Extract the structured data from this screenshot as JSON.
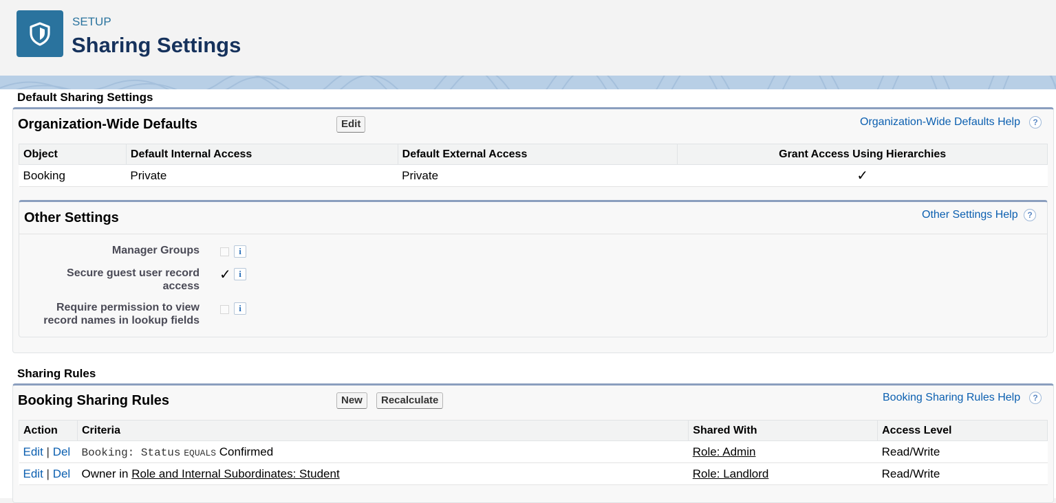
{
  "header": {
    "breadcrumb": "SETUP",
    "title": "Sharing Settings",
    "icon": "shield-icon",
    "icon_bg": "#2a739e"
  },
  "default_sharing": {
    "heading": "Default Sharing Settings",
    "owd": {
      "title": "Organization-Wide Defaults",
      "edit_label": "Edit",
      "help_label": "Organization-Wide Defaults Help",
      "help_icon": "?",
      "columns": [
        "Object",
        "Default Internal Access",
        "Default External Access",
        "Grant Access Using Hierarchies"
      ],
      "rows": [
        {
          "object": "Booking",
          "internal": "Private",
          "external": "Private",
          "hierarchies": "✓"
        }
      ]
    },
    "other": {
      "title": "Other Settings",
      "help_label": "Other Settings Help",
      "help_icon": "?",
      "info_icon": "i",
      "items": [
        {
          "label": "Manager Groups",
          "checked": false
        },
        {
          "label": "Secure guest user record access",
          "checked": true,
          "check": "✓"
        },
        {
          "label": "Require permission to view record names in lookup fields",
          "checked": false
        }
      ]
    }
  },
  "sharing_rules": {
    "heading": "Sharing Rules",
    "booking": {
      "title": "Booking Sharing Rules",
      "new_label": "New",
      "recalc_label": "Recalculate",
      "help_label": "Booking Sharing Rules Help",
      "help_icon": "?",
      "columns": [
        "Action",
        "Criteria",
        "Shared With",
        "Access Level"
      ],
      "action_edit": "Edit",
      "action_sep": "|",
      "action_del": "Del",
      "rows": [
        {
          "crit_obj": "Booking: Status",
          "crit_op": "EQUALS",
          "crit_val": "Confirmed",
          "shared_with": "Role: Admin",
          "access": "Read/Write"
        },
        {
          "crit_prefix": "Owner in",
          "crit_link": "Role and Internal Subordinates: Student",
          "shared_with": "Role: Landlord",
          "access": "Read/Write"
        }
      ]
    }
  }
}
